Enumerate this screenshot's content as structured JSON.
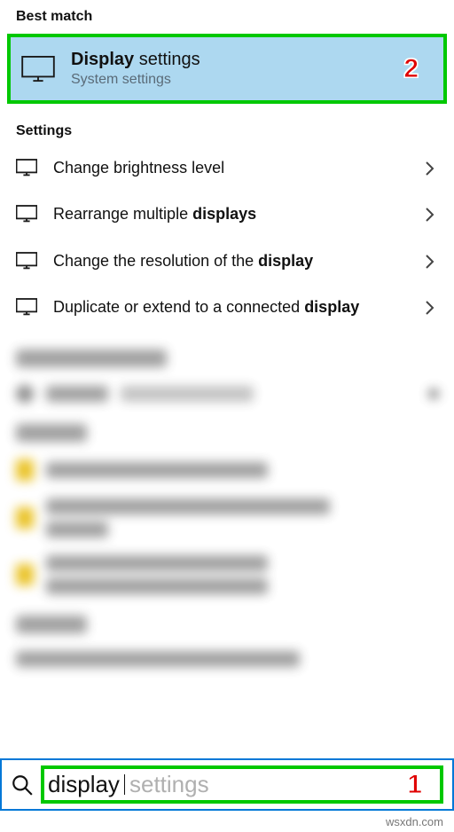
{
  "best_match": {
    "section_label": "Best match",
    "title_bold": "Display",
    "title_rest": " settings",
    "subtitle": "System settings",
    "step": "2"
  },
  "settings": {
    "section_label": "Settings",
    "items": [
      {
        "html": "Change brightness level"
      },
      {
        "html": "Rearrange multiple <strong>displays</strong>"
      },
      {
        "html": "Change the resolution of the <strong>display</strong>"
      },
      {
        "html": "Duplicate or extend to a connected <strong>display</strong>"
      }
    ]
  },
  "search": {
    "typed": "display",
    "suggestion_rest": " settings",
    "step": "1"
  },
  "watermark": "wsxdn.com"
}
